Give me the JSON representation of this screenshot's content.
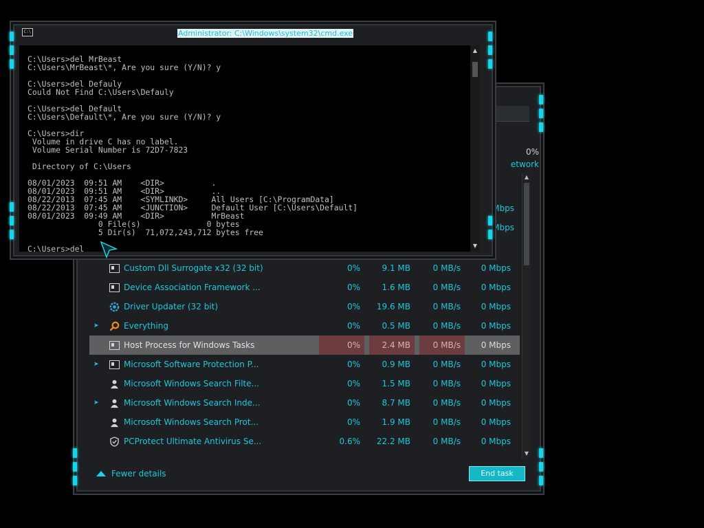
{
  "cmd": {
    "title": "Administrator: C:\\Windows\\system32\\cmd.exe",
    "icon_label": "C:\\",
    "lines": [
      "",
      "C:\\Users>del MrBeast",
      "C:\\Users\\MrBeast\\*, Are you sure (Y/N)? y",
      "",
      "C:\\Users>del Defauly",
      "Could Not Find C:\\Users\\Defauly",
      "",
      "C:\\Users>del Default",
      "C:\\Users\\Default\\*, Are you sure (Y/N)? y",
      "",
      "C:\\Users>dir",
      " Volume in drive C has no label.",
      " Volume Serial Number is 72D7-7823",
      "",
      " Directory of C:\\Users",
      "",
      "08/01/2023  09:51 AM    <DIR>          .",
      "08/01/2023  09:51 AM    <DIR>          ..",
      "08/22/2013  07:45 AM    <SYMLINKD>     All Users [C:\\ProgramData]",
      "08/22/2013  07:45 AM    <JUNCTION>     Default User [C:\\Users\\Default]",
      "08/01/2023  09:49 AM    <DIR>          MrBeast",
      "               0 File(s)              0 bytes",
      "               5 Dir(s)  71,072,243,712 bytes free",
      "",
      "C:\\Users>del "
    ]
  },
  "taskmanager": {
    "header_cpu_pct": "0%",
    "header_column": "etwork",
    "aux_mbps": [
      "Mbps",
      "Mbps"
    ],
    "rows": [
      {
        "name": "Custom Dll Surrogate x32 (32 bit)",
        "icon": "window-icon",
        "expand": false,
        "cpu": "0%",
        "mem": "9.1 MB",
        "disk": "0 MB/s",
        "net": "0 Mbps",
        "selected": false
      },
      {
        "name": "Device Association Framework ...",
        "icon": "window-icon",
        "expand": false,
        "cpu": "0%",
        "mem": "1.6 MB",
        "disk": "0 MB/s",
        "net": "0 Mbps",
        "selected": false
      },
      {
        "name": "Driver Updater (32 bit)",
        "icon": "gear-icon",
        "expand": false,
        "cpu": "0%",
        "mem": "19.6 MB",
        "disk": "0 MB/s",
        "net": "0 Mbps",
        "selected": false
      },
      {
        "name": "Everything",
        "icon": "magnifier-icon",
        "expand": true,
        "cpu": "0%",
        "mem": "0.5 MB",
        "disk": "0 MB/s",
        "net": "0 Mbps",
        "selected": false
      },
      {
        "name": "Host Process for Windows Tasks",
        "icon": "window-icon",
        "expand": false,
        "cpu": "0%",
        "mem": "2.4 MB",
        "disk": "0 MB/s",
        "net": "0 Mbps",
        "selected": true
      },
      {
        "name": "Microsoft Software Protection P...",
        "icon": "window-icon",
        "expand": true,
        "cpu": "0%",
        "mem": "0.9 MB",
        "disk": "0 MB/s",
        "net": "0 Mbps",
        "selected": false
      },
      {
        "name": "Microsoft Windows Search Filte...",
        "icon": "user-icon",
        "expand": false,
        "cpu": "0%",
        "mem": "1.5 MB",
        "disk": "0 MB/s",
        "net": "0 Mbps",
        "selected": false
      },
      {
        "name": "Microsoft Windows Search Inde...",
        "icon": "user-icon",
        "expand": true,
        "cpu": "0%",
        "mem": "8.7 MB",
        "disk": "0 MB/s",
        "net": "0 Mbps",
        "selected": false
      },
      {
        "name": "Microsoft Windows Search Prot...",
        "icon": "user-icon",
        "expand": false,
        "cpu": "0%",
        "mem": "1.9 MB",
        "disk": "0 MB/s",
        "net": "0 Mbps",
        "selected": false
      },
      {
        "name": "PCProtect Ultimate Antivirus Se...",
        "icon": "shield-icon",
        "expand": false,
        "cpu": "0.6%",
        "mem": "22.2 MB",
        "disk": "0 MB/s",
        "net": "0 Mbps",
        "selected": false
      }
    ],
    "fewer_details": "Fewer details",
    "end_task": "End task"
  },
  "colors": {
    "accent": "#19d4e8",
    "selected_row": "#5e5f61",
    "selected_heat": "#6d3c41"
  }
}
